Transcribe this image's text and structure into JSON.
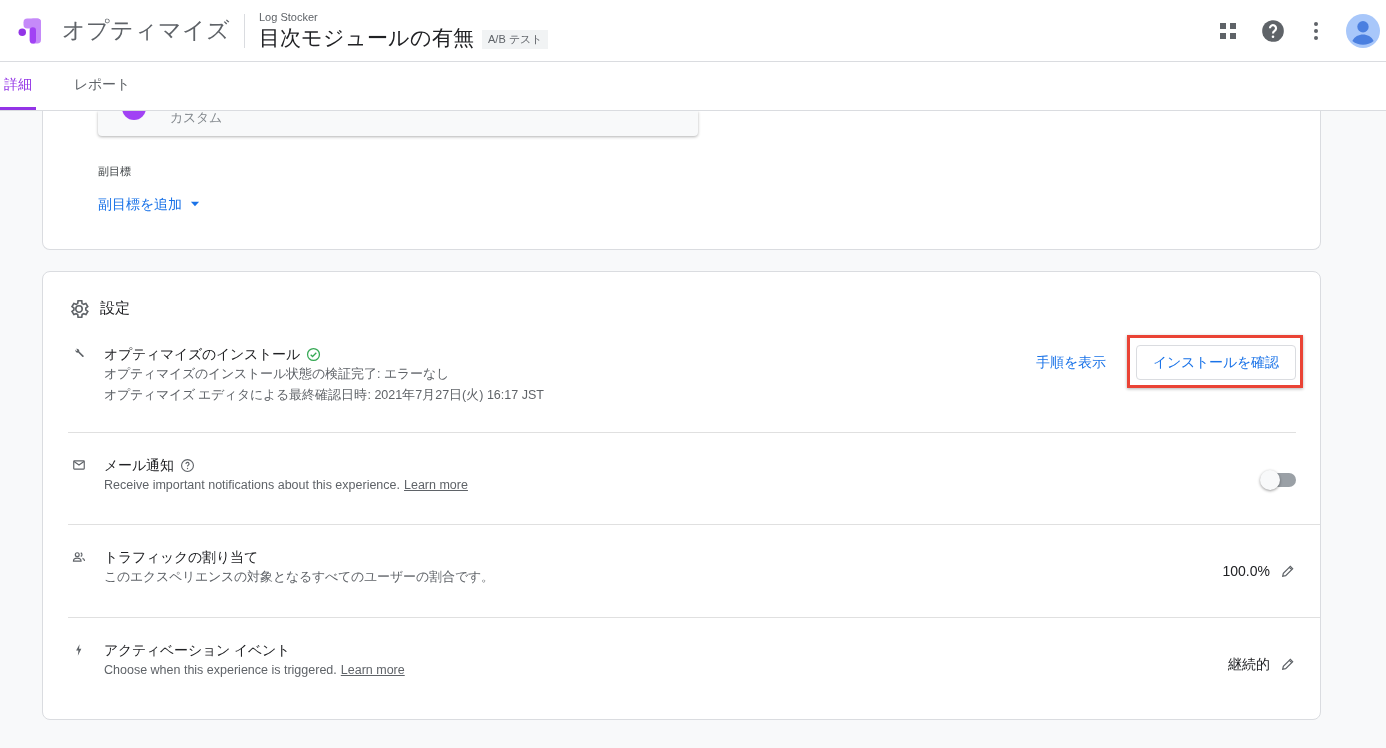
{
  "header": {
    "product": "オプティマイズ",
    "account": "Log Stocker",
    "title": "目次モジュールの有無",
    "badge": "A/B テスト"
  },
  "tabs": [
    {
      "label": "詳細",
      "selected": true
    },
    {
      "label": "レポート",
      "selected": false
    }
  ],
  "objective": {
    "subtitle": "カスタム"
  },
  "secondary": {
    "label": "副目標",
    "add_link": "副目標を追加"
  },
  "settings": {
    "title": "設定",
    "rows": [
      {
        "kind": "install",
        "title": "オプティマイズのインストール",
        "verified": true,
        "lines": [
          "オプティマイズのインストール状態の検証完了: エラーなし",
          "オプティマイズ エディタによる最終確認日時: 2021年7月27日(火) 16:17 JST"
        ],
        "link": "手順を表示",
        "button": {
          "label": "インストールを確認",
          "highlighted": true
        }
      },
      {
        "kind": "toggle",
        "title": "メール通知",
        "description": "Receive important notifications about this experience.",
        "link": "Learn more",
        "on": false
      },
      {
        "kind": "value",
        "title": "トラフィックの割り当て",
        "description": "このエクスペリエンスの対象となるすべてのユーザーの割合です。",
        "value": "100.0%"
      },
      {
        "kind": "value",
        "title": "アクティベーション イベント",
        "description": "Choose when this experience is triggered.",
        "link": "Learn more",
        "value": "継続的"
      }
    ]
  }
}
